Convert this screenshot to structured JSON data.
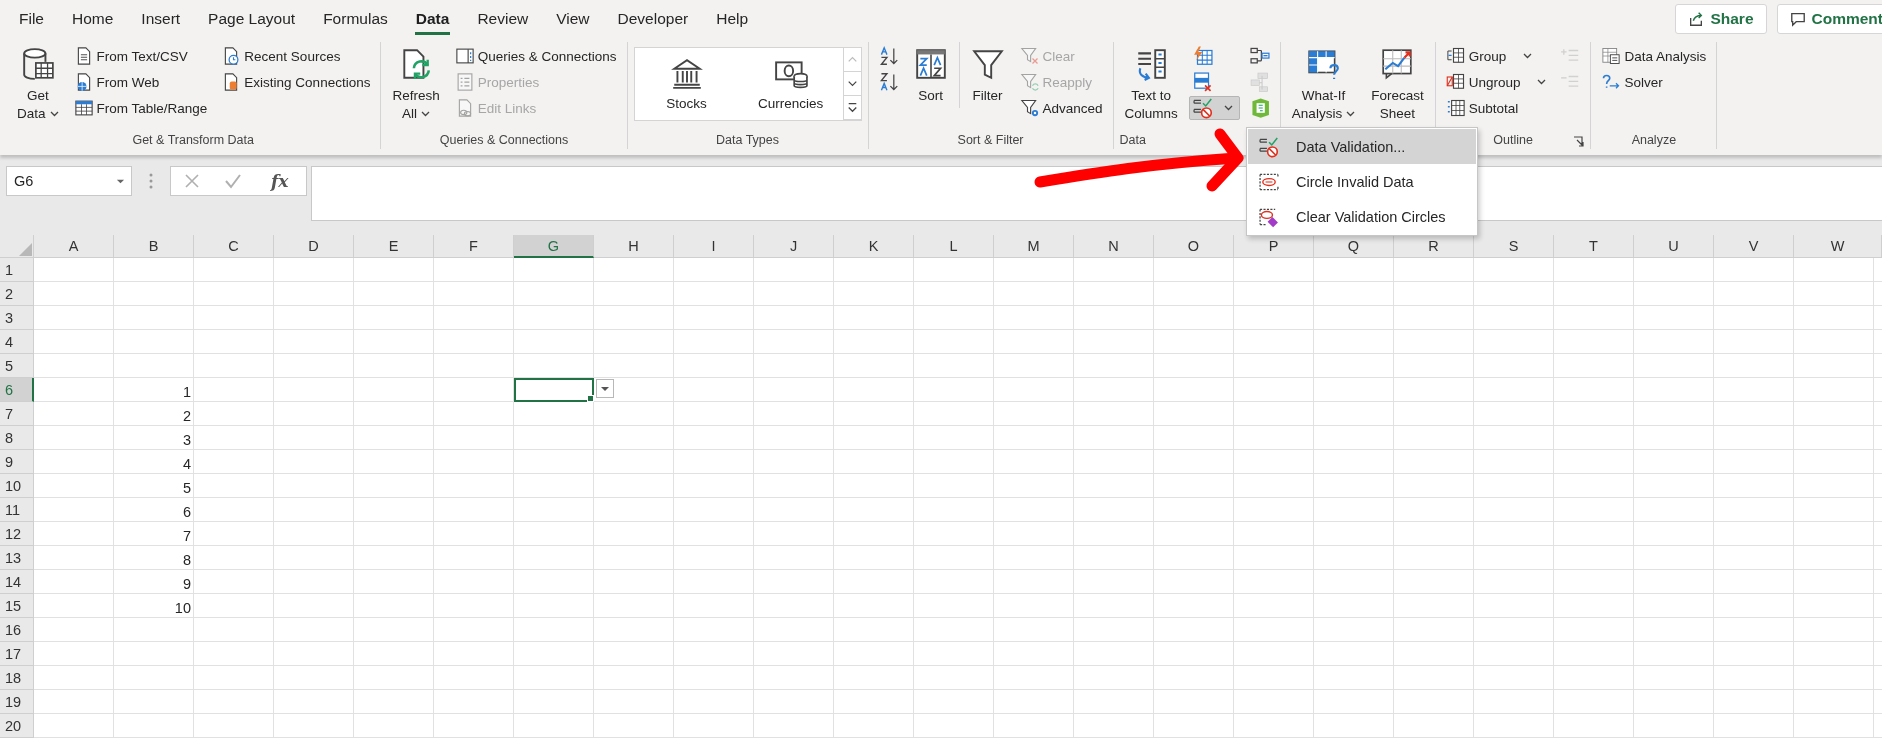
{
  "menu_tabs": [
    {
      "label": "File",
      "selected": false
    },
    {
      "label": "Home",
      "selected": false
    },
    {
      "label": "Insert",
      "selected": false
    },
    {
      "label": "Page Layout",
      "selected": false
    },
    {
      "label": "Formulas",
      "selected": false
    },
    {
      "label": "Data",
      "selected": true
    },
    {
      "label": "Review",
      "selected": false
    },
    {
      "label": "View",
      "selected": false
    },
    {
      "label": "Developer",
      "selected": false
    },
    {
      "label": "Help",
      "selected": false
    }
  ],
  "header_buttons": [
    {
      "label": "Share",
      "kind": "share"
    },
    {
      "label": "Comment",
      "kind": "comment"
    }
  ],
  "ribbon": {
    "groups": [
      {
        "label": "Get & Transform Data",
        "columns": [
          [
            {
              "kind": "large",
              "label": "Get\nData",
              "dropdown": true,
              "disabled": false
            }
          ],
          [
            {
              "kind": "small",
              "label": "From Text/CSV",
              "dropdown": false,
              "disabled": false
            },
            {
              "kind": "small",
              "label": "From Web",
              "dropdown": false,
              "disabled": false
            },
            {
              "kind": "small",
              "label": "From Table/Range",
              "dropdown": false,
              "disabled": false
            }
          ],
          [
            {
              "kind": "small",
              "label": "Recent Sources",
              "dropdown": false,
              "disabled": false
            },
            {
              "kind": "small",
              "label": "Existing Connections",
              "dropdown": false,
              "disabled": false
            }
          ]
        ]
      },
      {
        "label": "Queries & Connections",
        "columns": [
          [
            {
              "kind": "large",
              "label": "Refresh\nAll",
              "dropdown": true,
              "disabled": false
            }
          ],
          [
            {
              "kind": "small",
              "label": "Queries & Connections",
              "dropdown": false,
              "disabled": false
            },
            {
              "kind": "small",
              "label": "Properties",
              "dropdown": false,
              "disabled": true
            },
            {
              "kind": "small",
              "label": "Edit Links",
              "dropdown": false,
              "disabled": true
            }
          ]
        ]
      },
      {
        "label": "Data Types",
        "columns": [
          [
            {
              "kind": "gallery",
              "items": [
                {
                  "label": "Stocks"
                },
                {
                  "label": "Currencies"
                }
              ]
            }
          ]
        ]
      },
      {
        "label": "Sort & Filter",
        "columns": [
          [
            {
              "kind": "icon",
              "dropdown": false,
              "disabled": false,
              "pressed": false
            },
            {
              "kind": "icon",
              "dropdown": false,
              "disabled": false,
              "pressed": false
            }
          ],
          [
            {
              "kind": "large",
              "label": "Sort",
              "dropdown": false,
              "disabled": false
            }
          ],
          [
            {
              "kind": "large",
              "label": "Filter",
              "dropdown": false,
              "disabled": false
            }
          ],
          [
            {
              "kind": "small",
              "label": "Clear",
              "dropdown": false,
              "disabled": true
            },
            {
              "kind": "small",
              "label": "Reapply",
              "dropdown": false,
              "disabled": true
            },
            {
              "kind": "small",
              "label": "Advanced",
              "dropdown": false,
              "disabled": false
            }
          ]
        ]
      },
      {
        "label": "Data",
        "columns": [
          [
            {
              "kind": "large",
              "label": "Text to\nColumns",
              "dropdown": false,
              "disabled": false
            }
          ],
          [
            {
              "kind": "icon",
              "dropdown": false,
              "disabled": false,
              "pressed": false
            },
            {
              "kind": "icon",
              "dropdown": false,
              "disabled": false,
              "pressed": false
            },
            {
              "kind": "icon",
              "dropdown": true,
              "disabled": false,
              "pressed": true
            }
          ],
          [
            {
              "kind": "icon",
              "dropdown": false,
              "disabled": false,
              "pressed": false
            },
            {
              "kind": "icon",
              "dropdown": false,
              "disabled": true,
              "pressed": false
            },
            {
              "kind": "icon",
              "dropdown": false,
              "disabled": false,
              "pressed": false
            }
          ]
        ]
      },
      {
        "columns": [
          [
            {
              "kind": "large",
              "label": "What-If\nAnalysis",
              "dropdown": true,
              "disabled": false
            }
          ],
          [
            {
              "kind": "large",
              "label": "Forecast\nSheet",
              "dropdown": false,
              "disabled": false
            }
          ]
        ]
      },
      {
        "label": "Outline",
        "launcher": true,
        "columns": [
          [
            {
              "kind": "small",
              "label": "Group",
              "dropdown": true,
              "disabled": false
            },
            {
              "kind": "small",
              "label": "Ungroup",
              "dropdown": true,
              "disabled": false
            },
            {
              "kind": "small",
              "label": "Subtotal",
              "dropdown": false,
              "disabled": false
            }
          ],
          [
            {
              "kind": "icon",
              "dropdown": false,
              "disabled": true,
              "pressed": false
            },
            {
              "kind": "icon",
              "dropdown": false,
              "disabled": true,
              "pressed": false
            }
          ]
        ]
      },
      {
        "label": "Analyze",
        "columns": [
          [
            {
              "kind": "small",
              "label": "Data Analysis",
              "dropdown": false,
              "disabled": false
            },
            {
              "kind": "small",
              "label": "Solver",
              "dropdown": false,
              "disabled": false
            }
          ]
        ]
      }
    ]
  },
  "dropdown_menu": {
    "items": [
      {
        "label": "Data Validation...",
        "selected": true
      },
      {
        "label": "Circle Invalid Data",
        "selected": false
      },
      {
        "label": "Clear Validation Circles",
        "selected": false
      }
    ]
  },
  "formula_bar": {
    "name_box": "G6",
    "function_button": "fx"
  },
  "sheet": {
    "validation_dropdown": true,
    "columns": [
      {
        "label": "A",
        "selected": false
      },
      {
        "label": "B",
        "selected": false
      },
      {
        "label": "C",
        "selected": false
      },
      {
        "label": "D",
        "selected": false
      },
      {
        "label": "E",
        "selected": false
      },
      {
        "label": "F",
        "selected": false
      },
      {
        "label": "G",
        "selected": true
      },
      {
        "label": "H",
        "selected": false
      },
      {
        "label": "I",
        "selected": false
      },
      {
        "label": "J",
        "selected": false
      },
      {
        "label": "K",
        "selected": false
      },
      {
        "label": "L",
        "selected": false
      },
      {
        "label": "M",
        "selected": false
      },
      {
        "label": "N",
        "selected": false
      },
      {
        "label": "O",
        "selected": false
      },
      {
        "label": "P",
        "selected": false
      },
      {
        "label": "Q",
        "selected": false
      },
      {
        "label": "R",
        "selected": false
      },
      {
        "label": "S",
        "selected": false
      },
      {
        "label": "T",
        "selected": false
      },
      {
        "label": "U",
        "selected": false
      },
      {
        "label": "V",
        "selected": false
      },
      {
        "label": "W",
        "selected": false
      }
    ],
    "rows": [
      {
        "label": "1",
        "selected": false
      },
      {
        "label": "2",
        "selected": false
      },
      {
        "label": "3",
        "selected": false
      },
      {
        "label": "4",
        "selected": false
      },
      {
        "label": "5",
        "selected": false
      },
      {
        "label": "6",
        "selected": true,
        "cells": [
          null,
          "1"
        ]
      },
      {
        "label": "7",
        "selected": false,
        "cells": [
          null,
          "2"
        ]
      },
      {
        "label": "8",
        "selected": false,
        "cells": [
          null,
          "3"
        ]
      },
      {
        "label": "9",
        "selected": false,
        "cells": [
          null,
          "4"
        ]
      },
      {
        "label": "10",
        "selected": false,
        "cells": [
          null,
          "5"
        ]
      },
      {
        "label": "11",
        "selected": false,
        "cells": [
          null,
          "6"
        ]
      },
      {
        "label": "12",
        "selected": false,
        "cells": [
          null,
          "7"
        ]
      },
      {
        "label": "13",
        "selected": false,
        "cells": [
          null,
          "8"
        ]
      },
      {
        "label": "14",
        "selected": false,
        "cells": [
          null,
          "9"
        ]
      },
      {
        "label": "15",
        "selected": false,
        "cells": [
          null,
          "10"
        ]
      },
      {
        "label": "16",
        "selected": false
      },
      {
        "label": "17",
        "selected": false
      },
      {
        "label": "18",
        "selected": false
      },
      {
        "label": "19",
        "selected": false
      },
      {
        "label": "20",
        "selected": false
      }
    ]
  }
}
